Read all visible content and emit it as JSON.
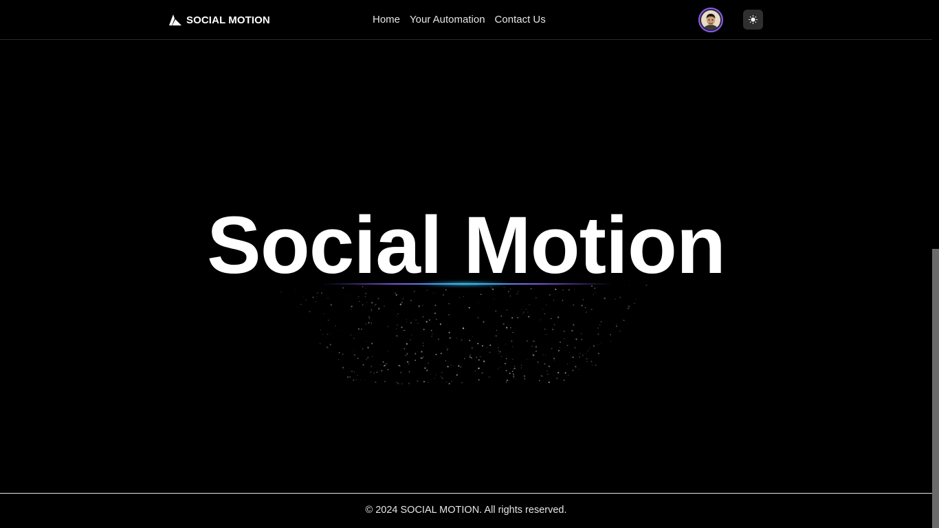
{
  "header": {
    "brand": "SOCIAL MOTION",
    "nav": [
      {
        "label": "Home"
      },
      {
        "label": "Your Automation"
      },
      {
        "label": "Contact Us"
      }
    ],
    "avatar_icon": "user-avatar",
    "theme_toggle_icon": "sun-icon"
  },
  "hero": {
    "title": "Social Motion"
  },
  "footer": {
    "text": "© 2024 SOCIAL MOTION. All rights reserved."
  },
  "colors": {
    "background": "#000000",
    "accent_purple": "#8b5cf6",
    "accent_blue": "#38bdf8"
  }
}
